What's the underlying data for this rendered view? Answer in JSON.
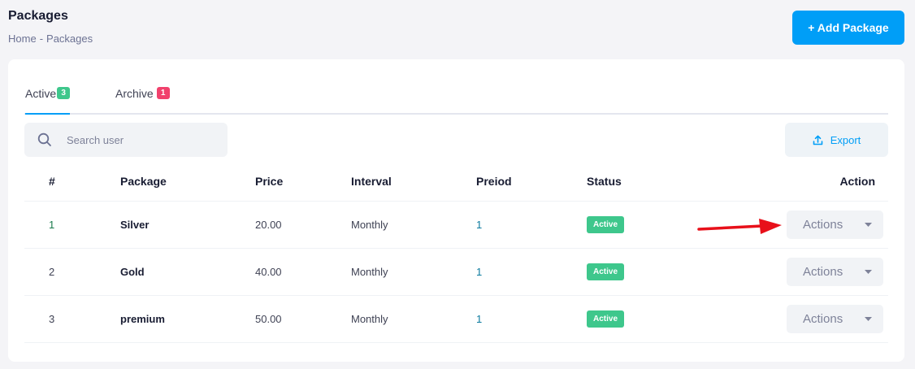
{
  "header": {
    "title": "Packages",
    "breadcrumb": [
      "Home",
      "-",
      "Packages"
    ],
    "add_button": "+ Add Package"
  },
  "tabs": [
    {
      "label": "Active",
      "count": "3"
    },
    {
      "label": "Archive",
      "count": "1"
    }
  ],
  "search": {
    "placeholder": "Search user",
    "icon": "search-icon"
  },
  "export": {
    "label": "Export",
    "icon": "upload-icon"
  },
  "table": {
    "columns": [
      "#",
      "Package",
      "Price",
      "Interval",
      "Preiod",
      "Status",
      "Action"
    ],
    "rows": [
      {
        "num": "1",
        "package": "Silver",
        "price": "20.00",
        "interval": "Monthly",
        "period": "1",
        "status": "Active",
        "action": "Actions"
      },
      {
        "num": "2",
        "package": "Gold",
        "price": "40.00",
        "interval": "Monthly",
        "period": "1",
        "status": "Active",
        "action": "Actions"
      },
      {
        "num": "3",
        "package": "premium",
        "price": "50.00",
        "interval": "Monthly",
        "period": "1",
        "status": "Active",
        "action": "Actions"
      }
    ]
  },
  "colors": {
    "primary": "#009ef7",
    "success": "#3ec78c",
    "danger": "#f1416c",
    "annotation_arrow": "#e8101a"
  }
}
